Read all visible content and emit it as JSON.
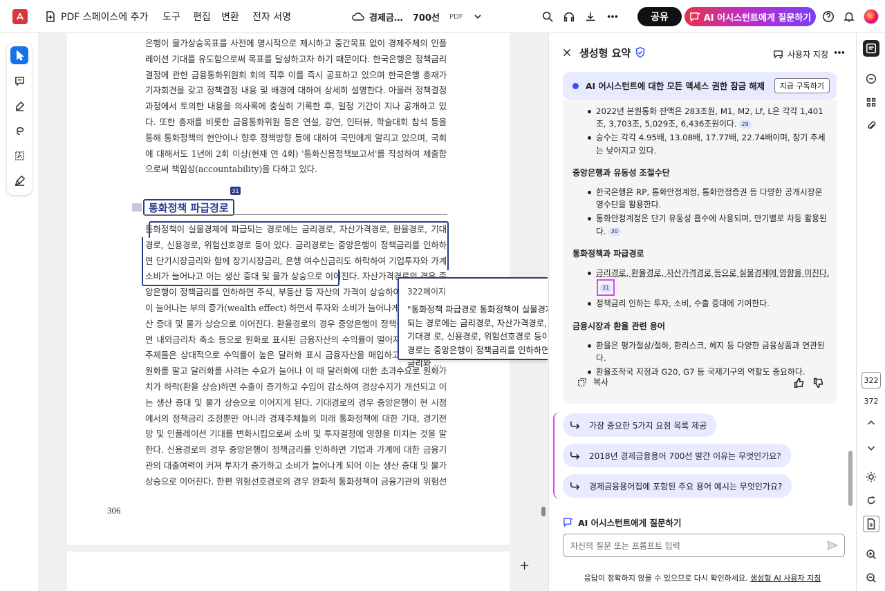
{
  "topbar": {
    "add_to_space": "PDF 스페이스에 추가",
    "menu": [
      "도구",
      "편집",
      "변환",
      "전자 서명"
    ],
    "doc_title": "경제금…",
    "doc_title_bold": "700선",
    "doc_type": "PDF",
    "share": "공유",
    "ai_button": "AI 어시스턴트에게 질문하기"
  },
  "document": {
    "paragraph1": "은행이 물가상승목표를 사전에 명시적으로 제시하고 중간목표 없이 경제주체의 인플레이션 기대를 유도함으로써 목표를 달성하고자 하기 때문이다. 한국은행은 정책금리 결정에 관한 금융통화위원회 회의 직후 이를 즉시 공표하고 있으며 한국은행 총재가 기자회견을 갖고 정책결정 내용 및 배경에 대하여 상세히 설명한다. 아울러 정책결정 과정에서 토의한 내용을 의사록에 충실히 기록한 후, 일정 기간이 지나 공개하고 있다. 또한 총재를 비롯한 금융통화위원 등은 연설, 강연, 인터뷰, 학술대회 참석 등을 통해 통화정책의 현안이나 향후 정책방향 등에 대하여 국민에게 알리고 있으며, 국회에 대해서도 1년에 2회 이상(현재 연 4회) '통화신용정책보고서'를 작성하여 제출함으로써 책임성(accountability)을 다하고 있다.",
    "cite_badge": "31",
    "heading": "통화정책 파급경로",
    "paragraph2": "통화정책이 실물경제에 파급되는 경로에는 금리경로, 자산가격경로, 환율경로, 기대경로, 신용경로, 위험선호경로 등이 있다. 금리경로는 중앙은행이 정책금리를 인하하면 단기시장금리와 함께 장기시장금리, 은행 여수신금리도 하락하여 기업투자와 가계소비가 늘어나고 이는 생산 증대 및 물가 상승으로 이어진다. 자산가격경로의 경우 중앙은행이 정책금리를 인하하면 주식, 부동산 등 자산의 가격이 상승하여 가계의 자산이 늘어나는 부의 증가(wealth effect) 하면서 투자와 소비가 늘어나게 되고 이는 생산 증대 및 물가 상승으로 이어진다. 환율경로의 경우 중앙은행이 정책금리를 인하하면 내외금리차 축소 등으로 원화로 표시된 금융자산의 수익률이 떨어지게 되어 경제주체들은 상대적으로 수익률이 높은 달러화 표시 금융자산을 매입하고자 하게 되며 원화를 팔고 달러화를 사려는 수요가 늘어나 이 때 달러화에 대한 초과수요로 원화가치가 하락(환율 상승)하면 수출이 증가하고 수입이 감소하여 경상수지가 개선되고 이는 생산 증대 및 물가 상승으로 이어지게 된다. 기대경로의 경우 중앙은행이 현 시점에서의 정책금리 조정뿐만 아니라 경제주체들의 미래 통화정책에 대한 기대, 경기전망 및 인플레이션 기대를 변화시킴으로써 소비 및 투자결정에 영향을 미치는 것을 말한다. 신용경로의 경우 중앙은행이 정책금리를 인하하면 기업과 가계에 대한 금융기관의 대출여력이 커져 투자가 증가하고 소비가 늘어나게 되어 이는 생산 증대 및 물가 상승으로 이어진다. 한편 위험선호경로의 경우 완화적 통화정책이 금융기관의 위험선호도 증대를 통해 고위험·고수익 대출 등을 증심",
    "page_number": "306",
    "popup_page": "322페이지",
    "popup_text": "\"통화정책 파급경로 통화정책이 실물경제에 파급되는 경로에는 금리경로, 자산가격경로, 환율경로, 기대경 로, 신용경로, 위험선호경로 등이 있다.금리경로는 중앙은행이 정책금리를 인하하면 단기시장금리와 …"
  },
  "panel": {
    "title": "생성형 요약",
    "customize": "사용자 지정",
    "unlock_text": "AI 어시스턴트에 대한 모든 액세스 권한 잠금 해제",
    "subscribe": "지금 구독하기",
    "b1": "2022년 본원통화 잔액은 283조원, M1, M2, Lf, L은 각각 1,401조, 3,703조, 5,029조, 6,436조원이다.",
    "c1": "29",
    "b2": "승수는 각각 4.95배, 13.08배, 17.77배, 22.74배이며, 장기 추세는 낮아지고 있다.",
    "h1": "중앙은행과 유동성 조절수단",
    "b3": "한국은행은 RP, 통화안정계정, 통화안정증권 등 다양한 공개시장운영수단을 활용한다.",
    "b4": "통화안정계정은 단기 유동성 흡수에 사용되며, 만기별로 차등 활용된다.",
    "c2": "30",
    "h2": "통화정책과 파급경로",
    "b5": "금리경로, 환율경로, 자산가격경로 등으로 실물경제에 영향을 미친다.",
    "c3": "31",
    "b6": "정책금리 인하는 투자, 소비, 수출 증대에 기여한다.",
    "h3": "금융시장과 환율 관련 용어",
    "b7": "환율은 평가절상/절하, 환리스크, 헤지 등 다양한 금융상품과 연관된다.",
    "b8": "환율조작국 지정과 G20, G7 등 국제기구의 역할도 중요하다.",
    "copy": "복사",
    "suggestions": [
      "가장 중요한 5가지 요점 목록 제공",
      "2018년 경제금융용어 700선 발간 이유는 무엇인가요?",
      "경제금융용어집에 포함된 주요 용어 예시는 무엇인가요?"
    ],
    "ask_title": "AI 어시스턴트에게 질문하기",
    "input_placeholder": "자신의 질문 또는 프롬프트 입력",
    "footer": "응답이 정확하지 않을 수 있으므로 다시 확인하세요.",
    "footer_link": "생성형 AI 사용자 지침"
  },
  "rail": {
    "current_page": "322",
    "total_pages": "372"
  },
  "colors": {
    "accent": "#2d3a8c",
    "highlight": "#e040fb",
    "brand": "#d7373f"
  }
}
